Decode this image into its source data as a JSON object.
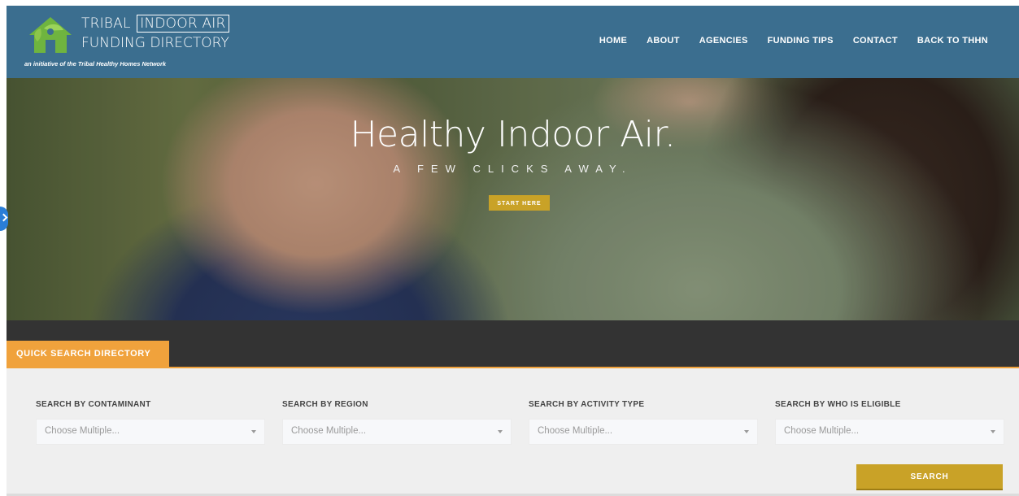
{
  "brand": {
    "line1_a": "TRIBAL",
    "line1_boxed": "INDOOR AIR",
    "line2": "FUNDING DIRECTORY",
    "tagline": "an initiative of the Tribal Healthy Homes Network",
    "colors": {
      "header": "#3b6e8f",
      "logo_green": "#6fb43f"
    }
  },
  "nav": {
    "items": [
      "HOME",
      "ABOUT",
      "AGENCIES",
      "FUNDING TIPS",
      "CONTACT",
      "BACK TO THHN"
    ]
  },
  "hero": {
    "title": "Healthy Indoor Air.",
    "subtitle": "A FEW CLICKS AWAY.",
    "cta_label": "START HERE",
    "cta_color": "#c9a227"
  },
  "quick_search": {
    "tab_label": "QUICK SEARCH DIRECTORY",
    "tab_color": "#f0a23c",
    "fields": [
      {
        "label": "SEARCH BY CONTAMINANT",
        "placeholder": "Choose Multiple..."
      },
      {
        "label": "SEARCH BY REGION",
        "placeholder": "Choose Multiple..."
      },
      {
        "label": "SEARCH BY ACTIVITY TYPE",
        "placeholder": "Choose Multiple..."
      },
      {
        "label": "SEARCH BY WHO IS ELIGIBLE",
        "placeholder": "Choose Multiple..."
      }
    ],
    "search_label": "SEARCH"
  }
}
